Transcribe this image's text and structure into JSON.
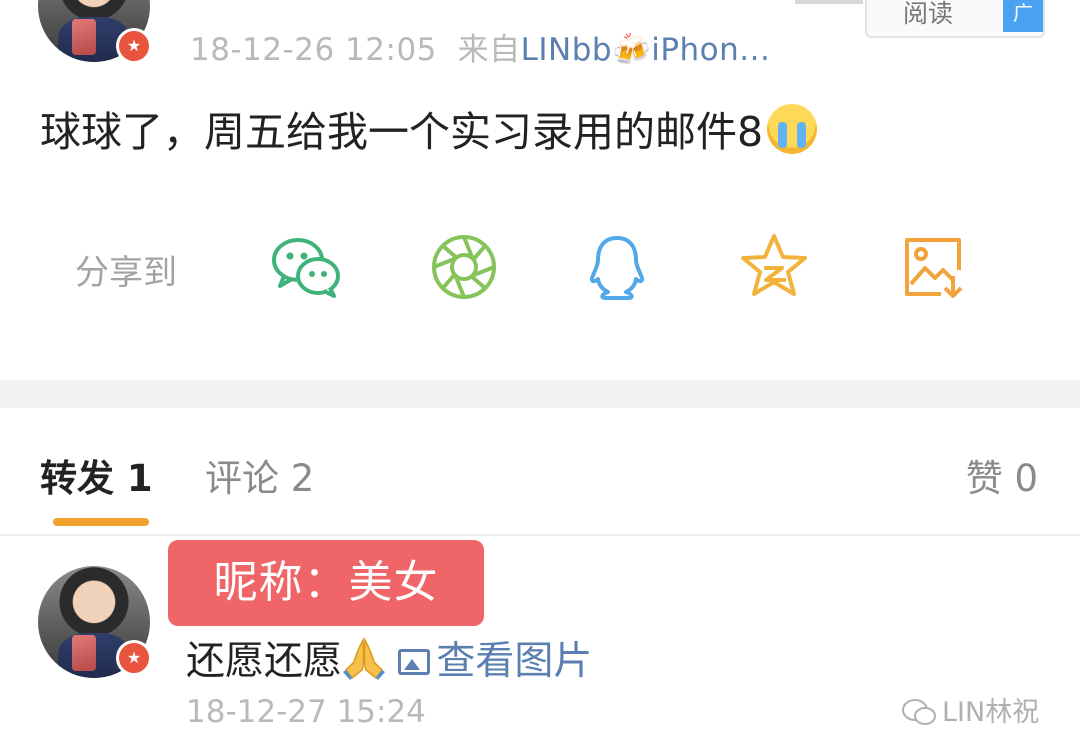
{
  "post": {
    "timestamp": "18-12-26 12:05",
    "source_prefix": "来自",
    "source_name": "LINbb",
    "source_suffix": "iPhon...",
    "read_label": "阅读",
    "ad_label": "广",
    "text": "球球了，周五给我一个实习录用的邮件8"
  },
  "share": {
    "label": "分享到",
    "icons": [
      "wechat-icon",
      "moments-icon",
      "qq-icon",
      "qzone-icon",
      "save-image-icon"
    ],
    "colors": {
      "wechat": "#3fb37a",
      "moments": "#86c35a",
      "qq": "#53a8e8",
      "qzone": "#f2b23b",
      "save": "#f2a33b"
    }
  },
  "tabs": {
    "repost": "转发 1",
    "comment": "评论 2",
    "like": "赞 0"
  },
  "repost": {
    "nickname_overlay": "昵称：美女",
    "text": "还愿还愿",
    "view_image_label": "查看图片",
    "timestamp": "18-12-27 15:24"
  },
  "watermark": {
    "text": "LIN林祝"
  },
  "colors": {
    "accent": "#f0a12e",
    "link": "#5b7fb1",
    "badge": "#e9543f",
    "overlay": "#ef5a5d"
  }
}
